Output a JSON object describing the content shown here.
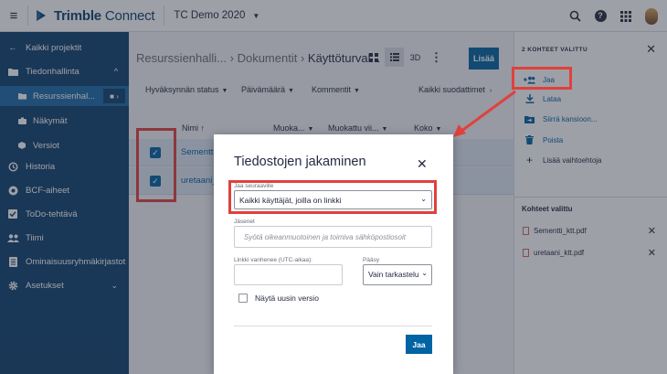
{
  "topbar": {
    "brand_bold": "Trimble",
    "brand_light": " Connect",
    "project": "TC Demo 2020"
  },
  "sidebar": {
    "items": [
      {
        "label": "Kaikki projektit",
        "icon": "arrow-left-icon"
      },
      {
        "label": "Tiedonhallinta",
        "icon": "folder-icon"
      },
      {
        "label": "Resurssienhal...",
        "icon": "folder-small-icon"
      },
      {
        "label": "Näkymät",
        "icon": "camera-icon"
      },
      {
        "label": "Versiot",
        "icon": "cube-icon"
      },
      {
        "label": "Historia",
        "icon": "history-icon"
      },
      {
        "label": "BCF-aiheet",
        "icon": "bcf-icon"
      },
      {
        "label": "ToDo-tehtävä",
        "icon": "checkbox-icon"
      },
      {
        "label": "Tiimi",
        "icon": "team-icon"
      },
      {
        "label": "Ominaisuusryhmäkirjastot",
        "icon": "library-icon"
      },
      {
        "label": "Asetukset",
        "icon": "gear-icon"
      }
    ]
  },
  "main": {
    "crumb_1": "Resurssienhalli...",
    "crumb_2": "Dokumentit",
    "crumb_current": "Käyttöturval...",
    "view_3d": "3D",
    "add_label": "Lisää",
    "filters": {
      "approval": "Hyväksynnän status",
      "date": "Päivämäärä",
      "comments": "Kommentit",
      "all": "Kaikki suodattimet"
    },
    "columns": {
      "name": "Nimi ↑",
      "modified": "Muoka...",
      "modified_by": "Muokattu vii...",
      "size": "Koko"
    },
    "rows": [
      {
        "name": "Sementti_"
      },
      {
        "name": "uretaani_"
      }
    ]
  },
  "modal": {
    "title": "Tiedostojen jakaminen",
    "share_with_label": "Jaa seuraaville",
    "share_with_value": "Kaikki käyttäjät, joilla on linkki",
    "members_label": "Jäsenet",
    "members_placeholder": "Syötä oikeanmuotoinen ja toimiva sähköpostiosoit",
    "expiry_label": "Linkki vanhenee (UTC-aikaa):",
    "access_label": "Pääsy",
    "access_value": "Vain tarkastelu",
    "latest_version_label": "Näytä uusin versio",
    "share_button": "Jaa"
  },
  "right_panel": {
    "header": "2 KOHTEET VALITTU",
    "actions": [
      {
        "label": "Jaa",
        "icon": "share-users-icon"
      },
      {
        "label": "Lataa",
        "icon": "download-icon"
      },
      {
        "label": "Siirrä kansioon...",
        "icon": "move-folder-icon"
      },
      {
        "label": "Poista",
        "icon": "trash-icon"
      },
      {
        "label": "Lisää vaihtoehtoja",
        "icon": "plus-icon"
      }
    ],
    "selected_title": "Kohteet valittu",
    "files": [
      {
        "name": "Sementti_ktt.pdf"
      },
      {
        "name": "uretaani_ktt.pdf"
      }
    ]
  },
  "colors": {
    "sidebar_bg": "#0e416c",
    "sidebar_active": "#1d6aa6",
    "primary": "#0063a3",
    "highlight": "#e0413c"
  }
}
